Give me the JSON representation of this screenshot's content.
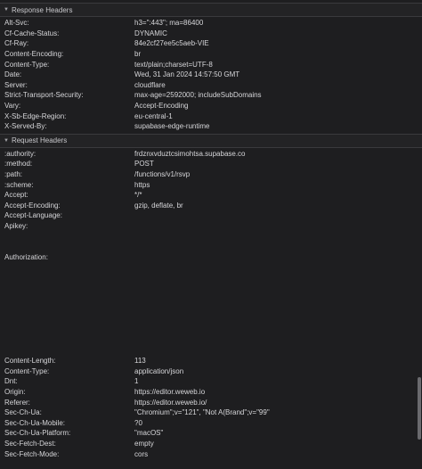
{
  "response": {
    "title": "Response Headers",
    "rows": [
      {
        "k": "Alt-Svc:",
        "v": "h3=\":443\"; ma=86400"
      },
      {
        "k": "Cf-Cache-Status:",
        "v": "DYNAMIC"
      },
      {
        "k": "Cf-Ray:",
        "v": "84e2cf27ee5c5aeb-VIE"
      },
      {
        "k": "Content-Encoding:",
        "v": "br"
      },
      {
        "k": "Content-Type:",
        "v": "text/plain;charset=UTF-8"
      },
      {
        "k": "Date:",
        "v": "Wed, 31 Jan 2024 14:57:50 GMT"
      },
      {
        "k": "Server:",
        "v": "cloudflare"
      },
      {
        "k": "Strict-Transport-Security:",
        "v": "max-age=2592000; includeSubDomains"
      },
      {
        "k": "Vary:",
        "v": "Accept-Encoding"
      },
      {
        "k": "X-Sb-Edge-Region:",
        "v": "eu-central-1"
      },
      {
        "k": "X-Served-By:",
        "v": "supabase-edge-runtime"
      }
    ]
  },
  "request": {
    "title": "Request Headers",
    "rows": [
      {
        "k": ":authority:",
        "v": "frdznxvduztcsimohtsa.supabase.co",
        "gap": 0
      },
      {
        "k": ":method:",
        "v": "POST",
        "gap": 0
      },
      {
        "k": ":path:",
        "v": "/functions/v1/rsvp",
        "gap": 0
      },
      {
        "k": ":scheme:",
        "v": "https",
        "gap": 0
      },
      {
        "k": "Accept:",
        "v": "*/*",
        "gap": 0
      },
      {
        "k": "Accept-Encoding:",
        "v": "gzip, deflate, br",
        "gap": 0
      },
      {
        "k": "Accept-Language:",
        "v": "",
        "gap": 0
      },
      {
        "k": "Apikey:",
        "v": "",
        "gap": 23
      },
      {
        "k": "Authorization:",
        "v": "",
        "gap": 105
      },
      {
        "k": "Content-Length:",
        "v": "113",
        "gap": 0
      },
      {
        "k": "Content-Type:",
        "v": "application/json",
        "gap": 0
      },
      {
        "k": "Dnt:",
        "v": "1",
        "gap": 0
      },
      {
        "k": "Origin:",
        "v": "https://editor.weweb.io",
        "gap": 0
      },
      {
        "k": "Referer:",
        "v": "https://editor.weweb.io/",
        "gap": 0
      },
      {
        "k": "Sec-Ch-Ua:",
        "v": "\"Chromium\";v=\"121\", \"Not A(Brand\";v=\"99\"",
        "gap": 0
      },
      {
        "k": "Sec-Ch-Ua-Mobile:",
        "v": "?0",
        "gap": 0
      },
      {
        "k": "Sec-Ch-Ua-Platform:",
        "v": "\"macOS\"",
        "gap": 0
      },
      {
        "k": "Sec-Fetch-Dest:",
        "v": "empty",
        "gap": 0
      },
      {
        "k": "Sec-Fetch-Mode:",
        "v": "cors",
        "gap": 0
      }
    ]
  }
}
